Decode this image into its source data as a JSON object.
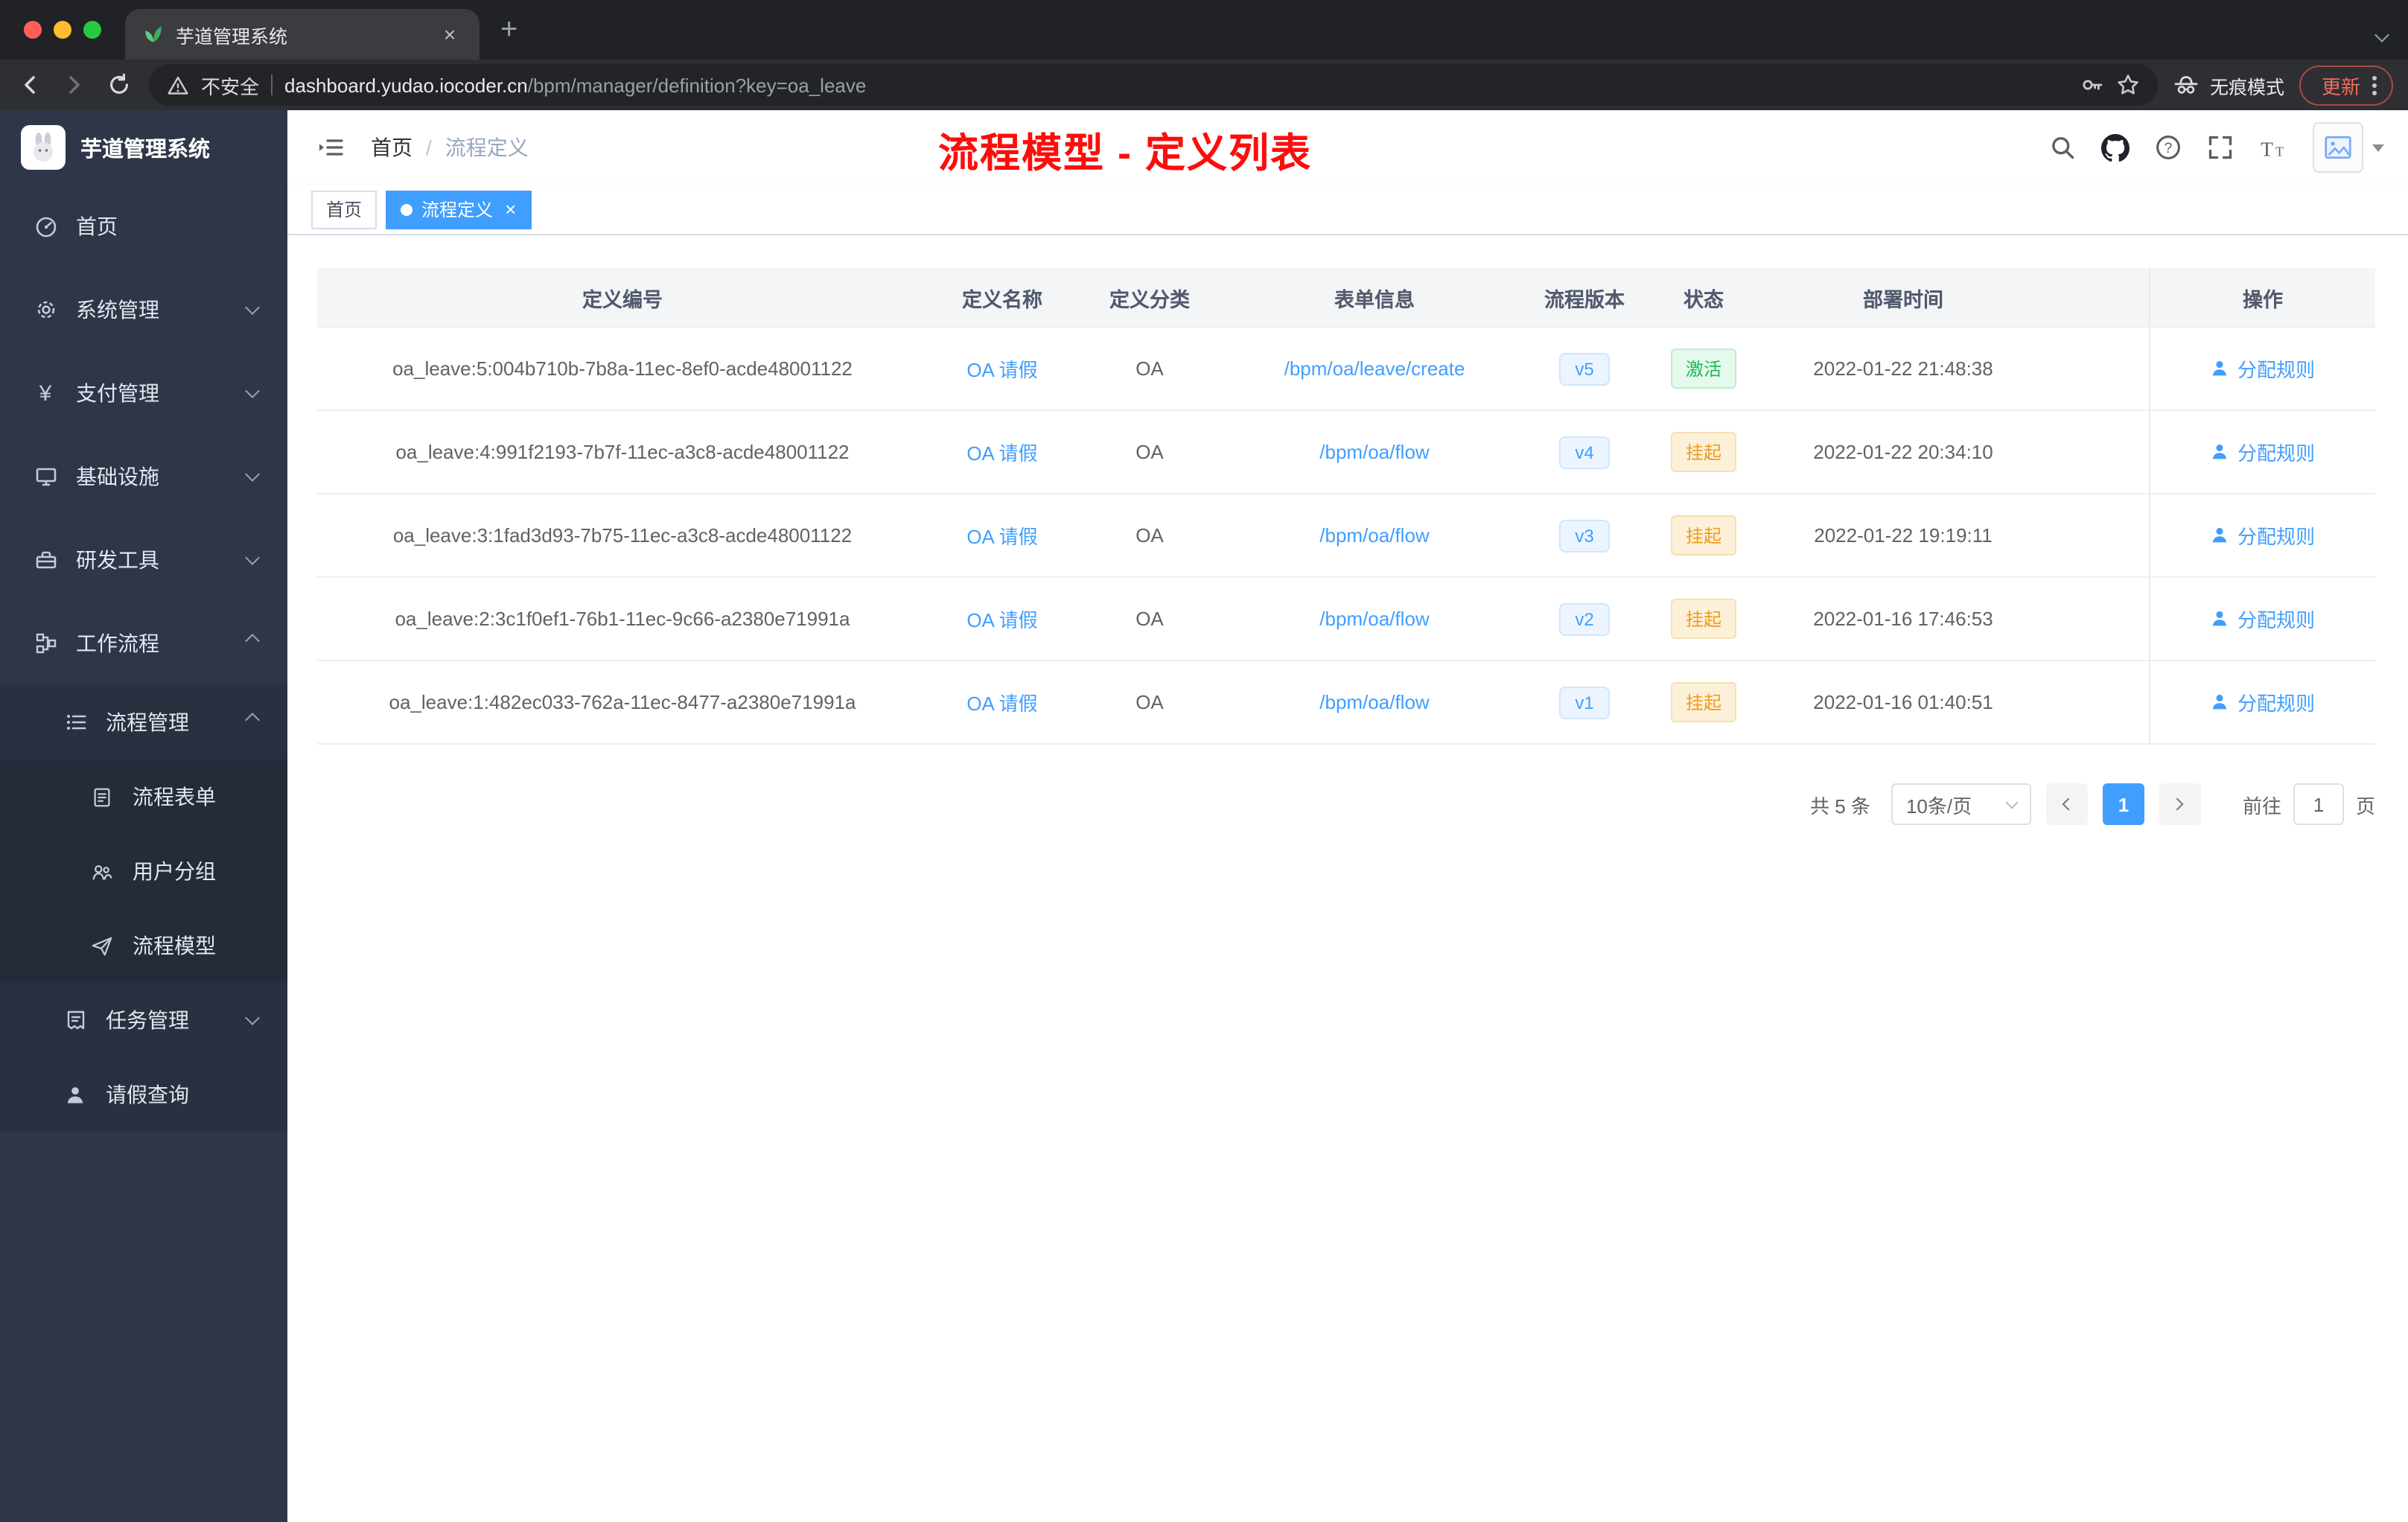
{
  "browser": {
    "tab_title": "芋道管理系统",
    "security_label": "不安全",
    "url_host": "dashboard.yudao.iocoder.cn",
    "url_path": "/bpm/manager/definition?key=oa_leave",
    "incognito_label": "无痕模式",
    "update_label": "更新",
    "new_tab_glyph": "+",
    "close_glyph": "×",
    "traffic_colors": [
      "#ff5f57",
      "#febc2e",
      "#28c840"
    ]
  },
  "sidebar": {
    "app_title": "芋道管理系统",
    "items": [
      {
        "label": "首页"
      },
      {
        "label": "系统管理"
      },
      {
        "label": "支付管理"
      },
      {
        "label": "基础设施"
      },
      {
        "label": "研发工具"
      },
      {
        "label": "工作流程"
      },
      {
        "label": "流程管理"
      },
      {
        "label": "流程表单"
      },
      {
        "label": "用户分组"
      },
      {
        "label": "流程模型"
      },
      {
        "label": "任务管理"
      },
      {
        "label": "请假查询"
      }
    ]
  },
  "header": {
    "breadcrumb_home": "首页",
    "breadcrumb_separator": "/",
    "breadcrumb_current": "流程定义",
    "annotation": "流程模型 - 定义列表"
  },
  "tags": {
    "home": "首页",
    "active": "流程定义",
    "close_glyph": "×"
  },
  "table": {
    "columns": [
      "定义编号",
      "定义名称",
      "定义分类",
      "表单信息",
      "流程版本",
      "状态",
      "部署时间",
      "操作"
    ],
    "rows": [
      {
        "id": "oa_leave:5:004b710b-7b8a-11ec-8ef0-acde48001122",
        "name": "OA 请假",
        "category": "OA",
        "form": "/bpm/oa/leave/create",
        "version": "v5",
        "status": "激活",
        "status_class": "badge status-success",
        "time": "2022-01-22 21:48:38",
        "action": "分配规则"
      },
      {
        "id": "oa_leave:4:991f2193-7b7f-11ec-a3c8-acde48001122",
        "name": "OA 请假",
        "category": "OA",
        "form": "/bpm/oa/flow",
        "version": "v4",
        "status": "挂起",
        "status_class": "badge status-warning",
        "time": "2022-01-22 20:34:10",
        "action": "分配规则"
      },
      {
        "id": "oa_leave:3:1fad3d93-7b75-11ec-a3c8-acde48001122",
        "name": "OA 请假",
        "category": "OA",
        "form": "/bpm/oa/flow",
        "version": "v3",
        "status": "挂起",
        "status_class": "badge status-warning",
        "time": "2022-01-22 19:19:11",
        "action": "分配规则"
      },
      {
        "id": "oa_leave:2:3c1f0ef1-76b1-11ec-9c66-a2380e71991a",
        "name": "OA 请假",
        "category": "OA",
        "form": "/bpm/oa/flow",
        "version": "v2",
        "status": "挂起",
        "status_class": "badge status-warning",
        "time": "2022-01-16 17:46:53",
        "action": "分配规则"
      },
      {
        "id": "oa_leave:1:482ec033-762a-11ec-8477-a2380e71991a",
        "name": "OA 请假",
        "category": "OA",
        "form": "/bpm/oa/flow",
        "version": "v1",
        "status": "挂起",
        "status_class": "badge status-warning",
        "time": "2022-01-16 01:40:51",
        "action": "分配规则"
      }
    ]
  },
  "pagination": {
    "total": "共 5 条",
    "page_size": "10条/页",
    "current_page": "1",
    "goto_label": "前往",
    "goto_value": "1",
    "unit_label": "页"
  },
  "colors": {
    "accent": "#409eff",
    "success": "#1cb95c",
    "warning": "#ee9c1e",
    "annotation": "#fe0d0d",
    "sidebar_bg": "#2e3648"
  }
}
